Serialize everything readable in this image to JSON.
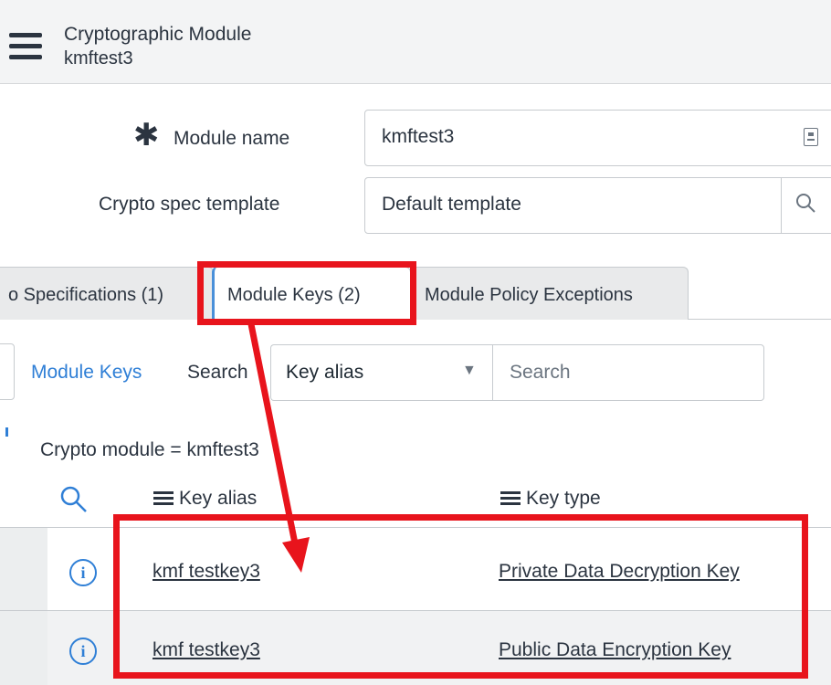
{
  "header": {
    "title": "Cryptographic Module",
    "subtitle": "kmftest3"
  },
  "form": {
    "module_name_label": "Module name",
    "module_name_value": "kmftest3",
    "template_label": "Crypto spec template",
    "template_value": "Default template"
  },
  "tabs": [
    {
      "label": "o Specifications (1)"
    },
    {
      "label": "Module Keys (2)",
      "active": true
    },
    {
      "label": "Module Policy Exceptions"
    }
  ],
  "list_toolbar": {
    "title_link": "Module Keys",
    "search_label": "Search",
    "field_select": "Key alias",
    "search_placeholder": "Search"
  },
  "list": {
    "filter_text": "Crypto module = kmftest3",
    "columns": [
      "Key alias",
      "Key type"
    ],
    "rows": [
      {
        "key_alias": "kmf testkey3",
        "key_type": "Private Data Decryption Key"
      },
      {
        "key_alias": "kmf testkey3",
        "key_type": "Public Data Encryption Key"
      }
    ]
  },
  "icons": {
    "menu": "hamburger-icon",
    "required": "asterisk-icon",
    "lookup": "magnifier-icon",
    "dropdown": "caret-down-icon",
    "info": "info-icon"
  },
  "colors": {
    "link": "#2f7fd6",
    "annotation": "#e8141c",
    "header_bg": "#f3f4f5"
  }
}
